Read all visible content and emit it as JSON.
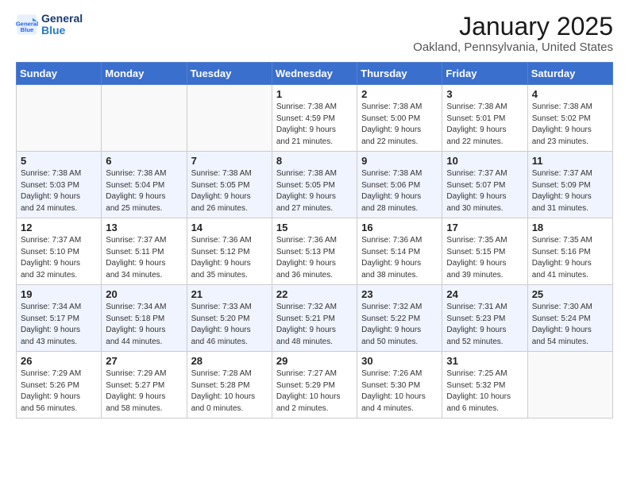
{
  "header": {
    "logo_line1": "General",
    "logo_line2": "Blue",
    "title": "January 2025",
    "subtitle": "Oakland, Pennsylvania, United States"
  },
  "weekdays": [
    "Sunday",
    "Monday",
    "Tuesday",
    "Wednesday",
    "Thursday",
    "Friday",
    "Saturday"
  ],
  "weeks": [
    {
      "days": [
        {
          "num": "",
          "info": ""
        },
        {
          "num": "",
          "info": ""
        },
        {
          "num": "",
          "info": ""
        },
        {
          "num": "1",
          "info": "Sunrise: 7:38 AM\nSunset: 4:59 PM\nDaylight: 9 hours\nand 21 minutes."
        },
        {
          "num": "2",
          "info": "Sunrise: 7:38 AM\nSunset: 5:00 PM\nDaylight: 9 hours\nand 22 minutes."
        },
        {
          "num": "3",
          "info": "Sunrise: 7:38 AM\nSunset: 5:01 PM\nDaylight: 9 hours\nand 22 minutes."
        },
        {
          "num": "4",
          "info": "Sunrise: 7:38 AM\nSunset: 5:02 PM\nDaylight: 9 hours\nand 23 minutes."
        }
      ]
    },
    {
      "days": [
        {
          "num": "5",
          "info": "Sunrise: 7:38 AM\nSunset: 5:03 PM\nDaylight: 9 hours\nand 24 minutes."
        },
        {
          "num": "6",
          "info": "Sunrise: 7:38 AM\nSunset: 5:04 PM\nDaylight: 9 hours\nand 25 minutes."
        },
        {
          "num": "7",
          "info": "Sunrise: 7:38 AM\nSunset: 5:05 PM\nDaylight: 9 hours\nand 26 minutes."
        },
        {
          "num": "8",
          "info": "Sunrise: 7:38 AM\nSunset: 5:05 PM\nDaylight: 9 hours\nand 27 minutes."
        },
        {
          "num": "9",
          "info": "Sunrise: 7:38 AM\nSunset: 5:06 PM\nDaylight: 9 hours\nand 28 minutes."
        },
        {
          "num": "10",
          "info": "Sunrise: 7:37 AM\nSunset: 5:07 PM\nDaylight: 9 hours\nand 30 minutes."
        },
        {
          "num": "11",
          "info": "Sunrise: 7:37 AM\nSunset: 5:09 PM\nDaylight: 9 hours\nand 31 minutes."
        }
      ]
    },
    {
      "days": [
        {
          "num": "12",
          "info": "Sunrise: 7:37 AM\nSunset: 5:10 PM\nDaylight: 9 hours\nand 32 minutes."
        },
        {
          "num": "13",
          "info": "Sunrise: 7:37 AM\nSunset: 5:11 PM\nDaylight: 9 hours\nand 34 minutes."
        },
        {
          "num": "14",
          "info": "Sunrise: 7:36 AM\nSunset: 5:12 PM\nDaylight: 9 hours\nand 35 minutes."
        },
        {
          "num": "15",
          "info": "Sunrise: 7:36 AM\nSunset: 5:13 PM\nDaylight: 9 hours\nand 36 minutes."
        },
        {
          "num": "16",
          "info": "Sunrise: 7:36 AM\nSunset: 5:14 PM\nDaylight: 9 hours\nand 38 minutes."
        },
        {
          "num": "17",
          "info": "Sunrise: 7:35 AM\nSunset: 5:15 PM\nDaylight: 9 hours\nand 39 minutes."
        },
        {
          "num": "18",
          "info": "Sunrise: 7:35 AM\nSunset: 5:16 PM\nDaylight: 9 hours\nand 41 minutes."
        }
      ]
    },
    {
      "days": [
        {
          "num": "19",
          "info": "Sunrise: 7:34 AM\nSunset: 5:17 PM\nDaylight: 9 hours\nand 43 minutes."
        },
        {
          "num": "20",
          "info": "Sunrise: 7:34 AM\nSunset: 5:18 PM\nDaylight: 9 hours\nand 44 minutes."
        },
        {
          "num": "21",
          "info": "Sunrise: 7:33 AM\nSunset: 5:20 PM\nDaylight: 9 hours\nand 46 minutes."
        },
        {
          "num": "22",
          "info": "Sunrise: 7:32 AM\nSunset: 5:21 PM\nDaylight: 9 hours\nand 48 minutes."
        },
        {
          "num": "23",
          "info": "Sunrise: 7:32 AM\nSunset: 5:22 PM\nDaylight: 9 hours\nand 50 minutes."
        },
        {
          "num": "24",
          "info": "Sunrise: 7:31 AM\nSunset: 5:23 PM\nDaylight: 9 hours\nand 52 minutes."
        },
        {
          "num": "25",
          "info": "Sunrise: 7:30 AM\nSunset: 5:24 PM\nDaylight: 9 hours\nand 54 minutes."
        }
      ]
    },
    {
      "days": [
        {
          "num": "26",
          "info": "Sunrise: 7:29 AM\nSunset: 5:26 PM\nDaylight: 9 hours\nand 56 minutes."
        },
        {
          "num": "27",
          "info": "Sunrise: 7:29 AM\nSunset: 5:27 PM\nDaylight: 9 hours\nand 58 minutes."
        },
        {
          "num": "28",
          "info": "Sunrise: 7:28 AM\nSunset: 5:28 PM\nDaylight: 10 hours\nand 0 minutes."
        },
        {
          "num": "29",
          "info": "Sunrise: 7:27 AM\nSunset: 5:29 PM\nDaylight: 10 hours\nand 2 minutes."
        },
        {
          "num": "30",
          "info": "Sunrise: 7:26 AM\nSunset: 5:30 PM\nDaylight: 10 hours\nand 4 minutes."
        },
        {
          "num": "31",
          "info": "Sunrise: 7:25 AM\nSunset: 5:32 PM\nDaylight: 10 hours\nand 6 minutes."
        },
        {
          "num": "",
          "info": ""
        }
      ]
    }
  ]
}
